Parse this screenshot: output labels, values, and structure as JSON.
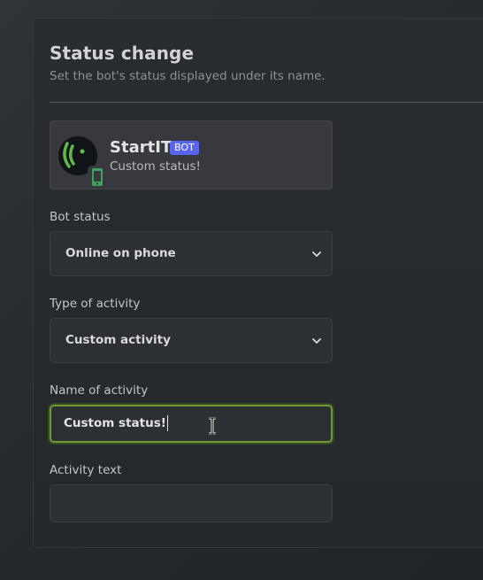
{
  "header": {
    "title": "Status change",
    "subtitle": "Set the bot's status displayed under its name."
  },
  "preview": {
    "bot_name": "StartIT",
    "bot_tag": "BOT",
    "status_text": "Custom status!",
    "avatar_colors": [
      "#111416",
      "#5fb94a"
    ]
  },
  "fields": {
    "bot_status": {
      "label": "Bot status",
      "value": "Online on phone"
    },
    "activity_type": {
      "label": "Type of activity",
      "value": "Custom activity"
    },
    "activity_name": {
      "label": "Name of activity",
      "value": "Custom status!"
    },
    "activity_text": {
      "label": "Activity text",
      "value": ""
    }
  },
  "colors": {
    "accent_focus": "#6d9b2c",
    "bot_tag": "#5865f2"
  }
}
